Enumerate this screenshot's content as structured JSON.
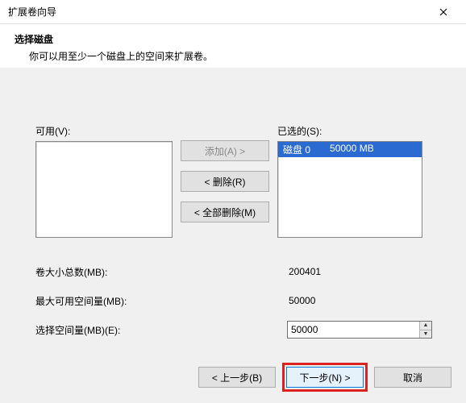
{
  "titlebar": {
    "title": "扩展卷向导"
  },
  "header": {
    "title": "选择磁盘",
    "subtitle": "你可以用至少一个磁盘上的空间来扩展卷。"
  },
  "labels": {
    "available": "可用(V):",
    "selected": "已选的(S):",
    "add": "添加(A) >",
    "remove": "< 删除(R)",
    "remove_all": "< 全部删除(M)",
    "total_size": "卷大小总数(MB):",
    "max_space": "最大可用空间量(MB):",
    "select_space": "选择空间量(MB)(E):",
    "back": "< 上一步(B)",
    "next": "下一步(N) >",
    "cancel": "取消"
  },
  "selected_list": [
    {
      "name": "磁盘 0",
      "size": "50000 MB"
    }
  ],
  "values": {
    "total_size": "200401",
    "max_space": "50000",
    "select_space": "50000"
  }
}
